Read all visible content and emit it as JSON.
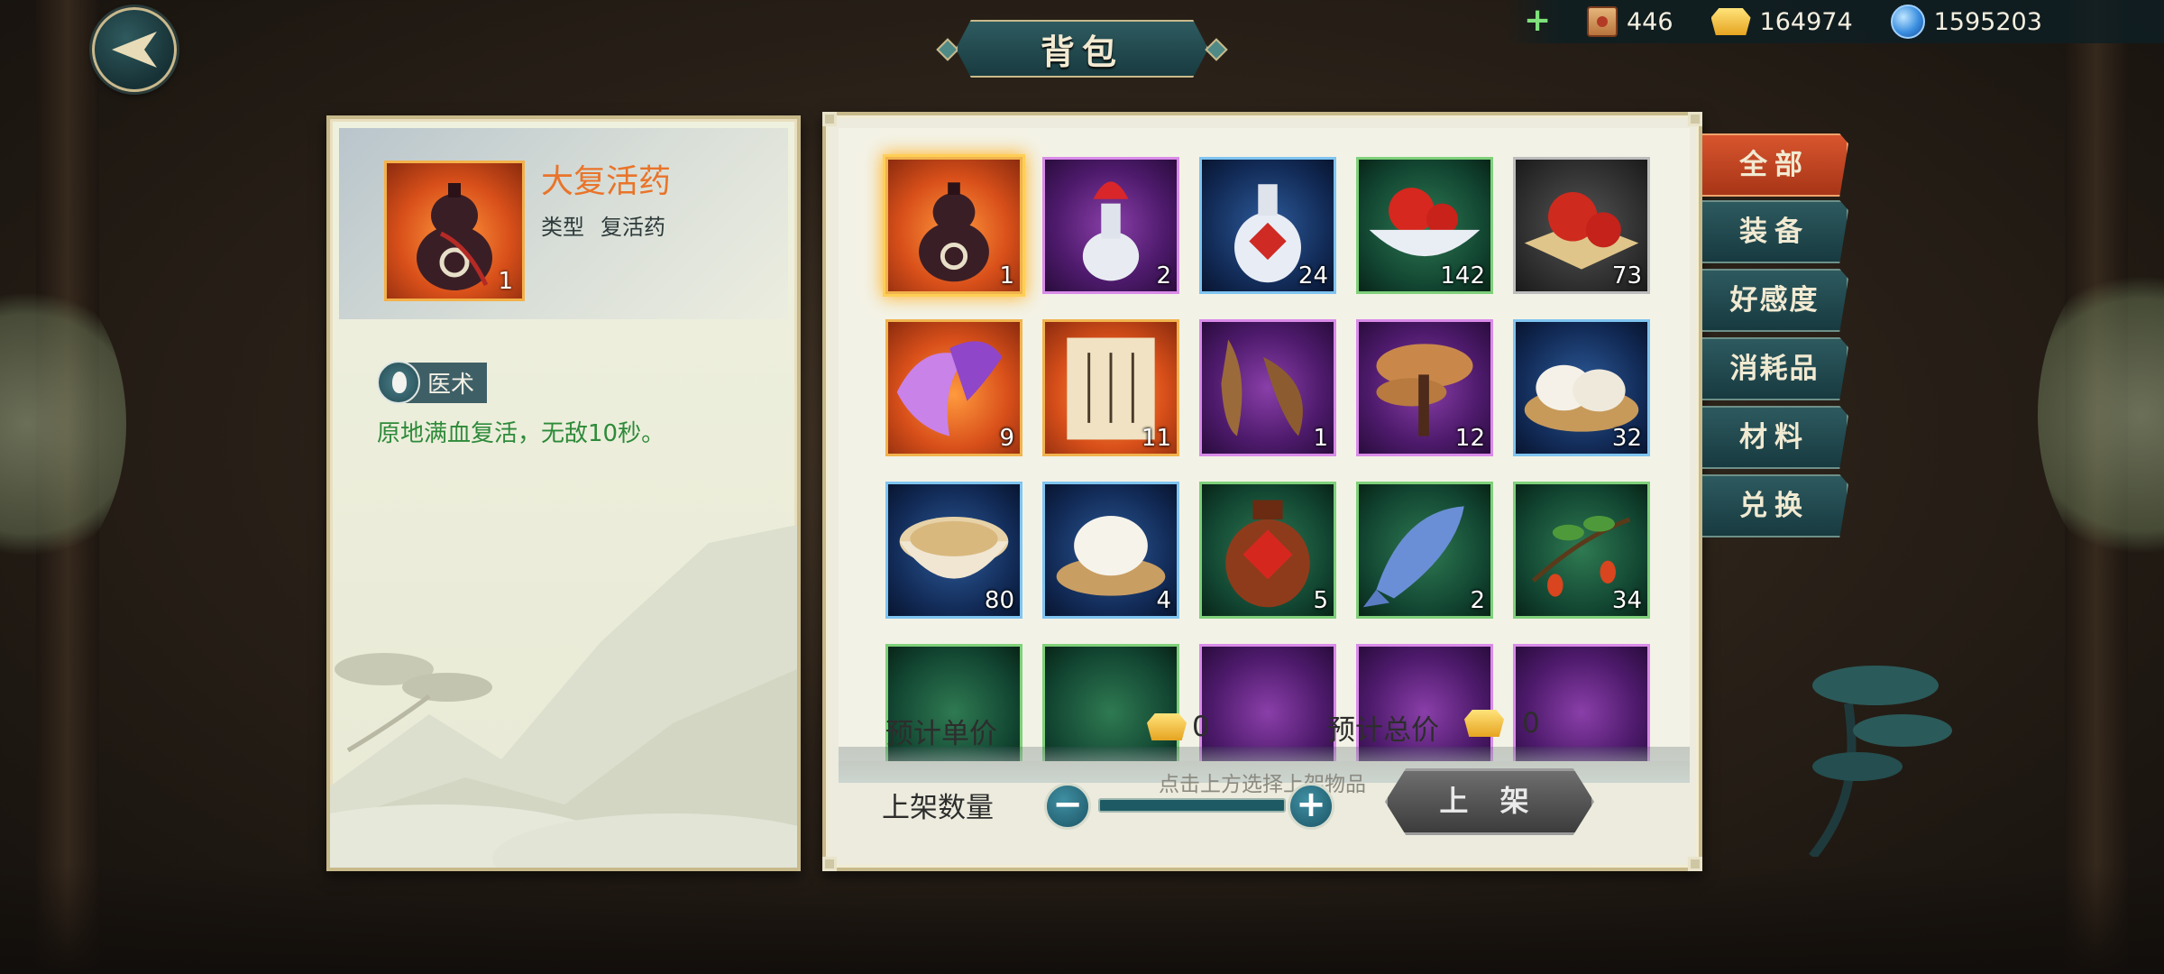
{
  "header": {
    "title": "背包",
    "currencies": [
      {
        "icon": "scroll-token-icon",
        "value": "446"
      },
      {
        "icon": "gold-ingot-icon",
        "value": "164974"
      },
      {
        "icon": "blue-orb-icon",
        "value": "1595203"
      }
    ]
  },
  "detail": {
    "item_name": "大复活药",
    "type_label": "类型",
    "type_value": "复活药",
    "count": "1",
    "skill_tag": "医术",
    "description": "原地满血复活，无敌10秒。"
  },
  "inventory": {
    "items": [
      {
        "name": "gourd-potion",
        "quality": "orange",
        "count": "1",
        "selected": true
      },
      {
        "name": "vase-potion",
        "quality": "purple",
        "count": "2"
      },
      {
        "name": "porcelain-wine-bottle",
        "quality": "blue",
        "count": "24"
      },
      {
        "name": "red-fruit-bowl",
        "quality": "green",
        "count": "142"
      },
      {
        "name": "red-fruit-plate",
        "quality": "gray",
        "count": "73"
      },
      {
        "name": "purple-dragon-fan",
        "quality": "orange",
        "count": "9"
      },
      {
        "name": "scroll-letter",
        "quality": "orange",
        "count": "11"
      },
      {
        "name": "bean-pods",
        "quality": "purple",
        "count": "1"
      },
      {
        "name": "lingzhi-mushroom",
        "quality": "purple",
        "count": "12"
      },
      {
        "name": "steamed-buns",
        "quality": "blue",
        "count": "32"
      },
      {
        "name": "soup-bowl",
        "quality": "blue",
        "count": "80"
      },
      {
        "name": "rice-plate",
        "quality": "blue",
        "count": "4"
      },
      {
        "name": "rice-wine-jar",
        "quality": "green",
        "count": "5"
      },
      {
        "name": "blue-fish",
        "quality": "green",
        "count": "2"
      },
      {
        "name": "goji-berry-branch",
        "quality": "green",
        "count": "34"
      }
    ],
    "hint": "点击上方选择上架物品",
    "unit_price_label": "预计单价",
    "unit_price_value": "0",
    "total_price_label": "预计总价",
    "total_price_value": "0",
    "quantity_label": "上架数量",
    "list_button": "上 架"
  },
  "tabs": [
    {
      "label": "全部",
      "active": true
    },
    {
      "label": "装备"
    },
    {
      "label": "好感度"
    },
    {
      "label": "消耗品"
    },
    {
      "label": "材料"
    },
    {
      "label": "兑换"
    }
  ],
  "colors": {
    "orange_quality": "#f1b34d",
    "purple_quality": "#d98be8",
    "blue_quality": "#7fc4f0",
    "green_quality": "#7fd07a",
    "description_green": "#2e8a3a",
    "item_name_orange": "#e9742a",
    "active_tab": "#c8481f"
  }
}
